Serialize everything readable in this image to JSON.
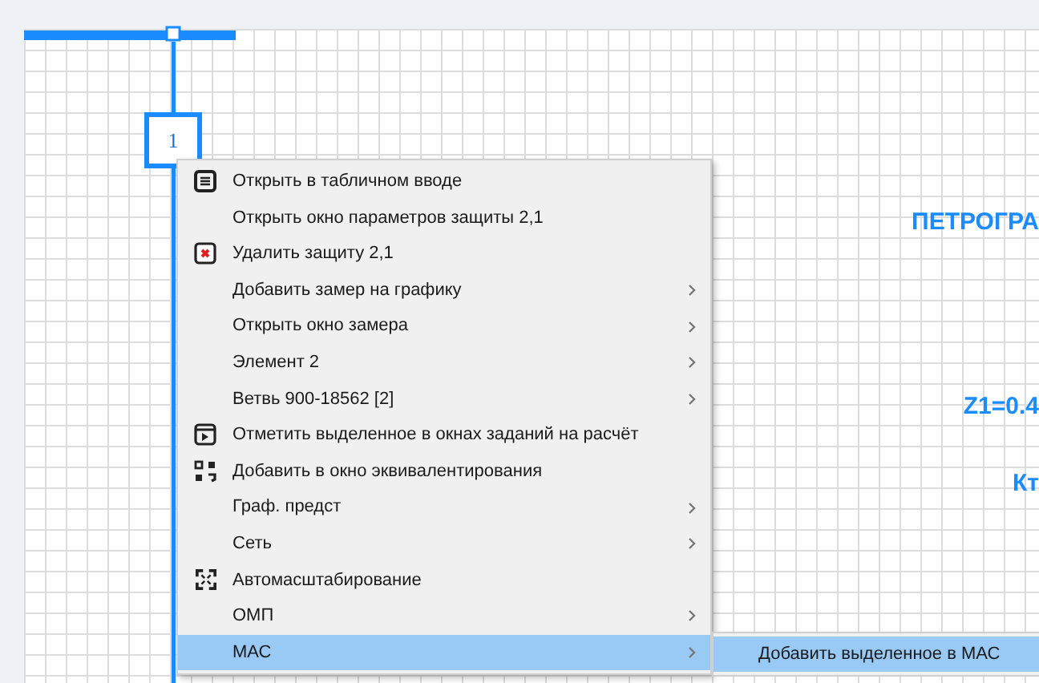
{
  "diagram": {
    "node_label": "1",
    "labels": [
      {
        "text": "ПЕТРОГРА"
      },
      {
        "text": "Z1=0.4"
      },
      {
        "text": "Кт"
      }
    ]
  },
  "context_menu": {
    "items": [
      {
        "label": "Открыть в табличном вводе",
        "submenu": false,
        "selected": false
      },
      {
        "label": "Открыть окно параметров защиты 2,1",
        "submenu": false,
        "selected": false
      },
      {
        "label": "Удалить защиту 2,1",
        "submenu": false,
        "selected": false
      },
      {
        "label": "Добавить замер на графику",
        "submenu": true,
        "selected": false
      },
      {
        "label": "Открыть окно замера",
        "submenu": true,
        "selected": false
      },
      {
        "label": "Элемент 2",
        "submenu": true,
        "selected": false
      },
      {
        "label": "Ветвь 900-18562 [2]",
        "submenu": true,
        "selected": false
      },
      {
        "label": "Отметить выделенное в окнах заданий на расчёт",
        "submenu": false,
        "selected": false
      },
      {
        "label": "Добавить в окно эквивалентирования",
        "submenu": false,
        "selected": false
      },
      {
        "label": "Граф. предст",
        "submenu": true,
        "selected": false
      },
      {
        "label": "Сеть",
        "submenu": true,
        "selected": false
      },
      {
        "label": "Автомасштабирование",
        "submenu": false,
        "selected": false
      },
      {
        "label": "ОМП",
        "submenu": true,
        "selected": false
      },
      {
        "label": "МАС",
        "submenu": true,
        "selected": true
      }
    ]
  },
  "submenu": {
    "items": [
      {
        "label": "Добавить выделенное в МАС",
        "selected": true
      }
    ]
  }
}
